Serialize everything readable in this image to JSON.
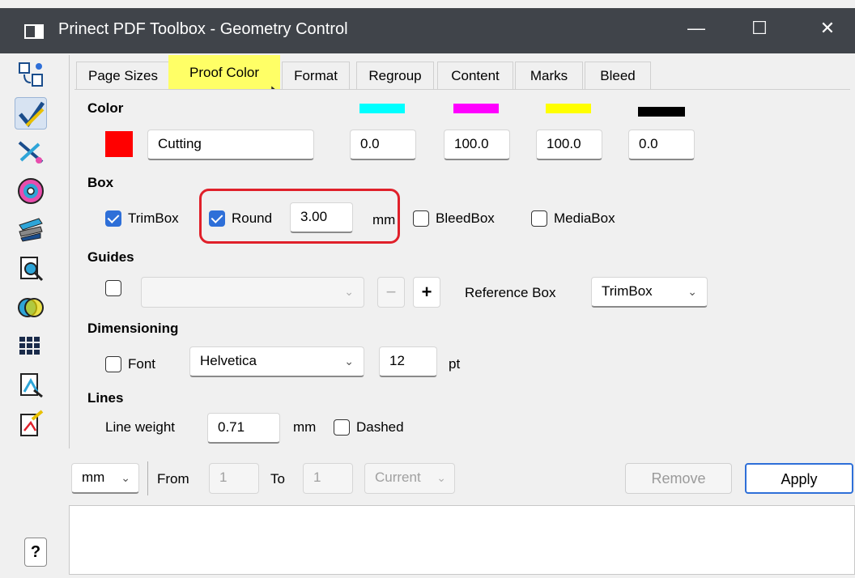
{
  "window": {
    "title": "Prinect PDF Toolbox - Geometry Control",
    "minimize": "—",
    "maximize": "☐",
    "close": "✕"
  },
  "tabs": [
    "Page Sizes",
    "Proof Color",
    "Format",
    "Regroup",
    "Content",
    "Marks",
    "Bleed"
  ],
  "active_tab": "Proof Color",
  "color": {
    "section": "Color",
    "swatch_color": "#ff0000",
    "name": "Cutting",
    "cmyk_colors": [
      "#00ffff",
      "#ff00ff",
      "#ffff00",
      "#000000"
    ],
    "c": "0.0",
    "m": "100.0",
    "y": "100.0",
    "k": "0.0"
  },
  "box": {
    "section": "Box",
    "trimbox": "TrimBox",
    "round": "Round",
    "round_value": "3.00",
    "round_unit": "mm",
    "bleedbox": "BleedBox",
    "mediabox": "MediaBox"
  },
  "guides": {
    "section": "Guides",
    "minus": "−",
    "plus": "+",
    "reference_label": "Reference Box",
    "reference_value": "TrimBox"
  },
  "dimensioning": {
    "section": "Dimensioning",
    "font_label": "Font",
    "font_value": "Helvetica",
    "size_value": "12",
    "size_unit": "pt"
  },
  "lines": {
    "section": "Lines",
    "weight_label": "Line weight",
    "weight_value": "0.71",
    "weight_unit": "mm",
    "dashed": "Dashed"
  },
  "bottom": {
    "unit": "mm",
    "from_label": "From",
    "from_value": "1",
    "to_label": "To",
    "to_value": "1",
    "scope": "Current",
    "remove": "Remove",
    "apply": "Apply"
  },
  "help": "?"
}
